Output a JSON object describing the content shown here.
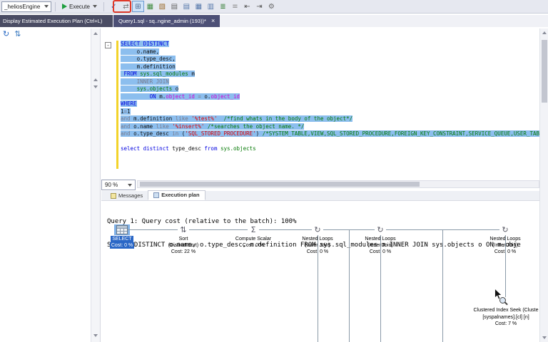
{
  "toolbar": {
    "database_combo": {
      "value": "_heliosEngine"
    },
    "execute": {
      "label": "Execute"
    },
    "icons": [
      {
        "name": "parse-query-icon",
        "glyph": "✓",
        "color": "#1f66c9"
      },
      {
        "name": "change-connection-icon",
        "glyph": "⇄",
        "color": "#777777"
      },
      {
        "name": "display-estimated-execution-plan-icon",
        "glyph": "⊞",
        "color": "#48648c",
        "highlighted": true
      },
      {
        "name": "live-query-statistics-icon",
        "glyph": "▦",
        "color": "#3f8a3f"
      },
      {
        "name": "include-actual-execution-plan-icon",
        "glyph": "▧",
        "color": "#9a6a2a"
      },
      {
        "name": "include-client-statistics-icon",
        "glyph": "▤",
        "color": "#666666"
      },
      {
        "name": "results-to-text-icon",
        "glyph": "▤",
        "color": "#5577aa"
      },
      {
        "name": "results-to-grid-icon",
        "glyph": "▦",
        "color": "#5577aa"
      },
      {
        "name": "results-to-file-icon",
        "glyph": "▥",
        "color": "#5577aa"
      },
      {
        "name": "comment-selection-icon",
        "glyph": "≣",
        "color": "#2f7a2f"
      },
      {
        "name": "uncomment-selection-icon",
        "glyph": "≡",
        "color": "#888888"
      },
      {
        "name": "decrease-indent-icon",
        "glyph": "⇤",
        "color": "#555555"
      },
      {
        "name": "increase-indent-icon",
        "glyph": "⇥",
        "color": "#555555"
      },
      {
        "name": "query-options-icon",
        "glyph": "⚙",
        "color": "#666666"
      }
    ]
  },
  "tooltip": {
    "text": "Display Estimated Execution Plan (Ctrl+L)"
  },
  "document_tab": {
    "title": "Query1.sql - sq..ngine_admin (193))*",
    "close_glyph": "×"
  },
  "left_panel": {
    "icons": [
      {
        "name": "refresh-icon",
        "glyph": "↻",
        "color": "#2668c4"
      },
      {
        "name": "sync-icon",
        "glyph": "⇅",
        "color": "#3a7ac0"
      }
    ]
  },
  "editor": {
    "collapse_glyph": "-",
    "lines": [
      {
        "selected": true,
        "segments": [
          [
            "kw",
            "SELECT DISTINCT"
          ]
        ]
      },
      {
        "selected": true,
        "segments": [
          [
            "id",
            "     o.name,"
          ]
        ]
      },
      {
        "selected": true,
        "segments": [
          [
            "id",
            "     o.type_desc,"
          ]
        ]
      },
      {
        "selected": true,
        "segments": [
          [
            "id",
            "     m.definition"
          ]
        ]
      },
      {
        "selected": true,
        "segments": [
          [
            "kw",
            " FROM "
          ],
          [
            "sys",
            "sys.sql_modules"
          ],
          [
            "id",
            " m"
          ]
        ]
      },
      {
        "selected": true,
        "segments": [
          [
            "op",
            "     INNER JOIN"
          ]
        ]
      },
      {
        "selected": true,
        "segments": [
          [
            "id",
            "     "
          ],
          [
            "sys",
            "sys.objects"
          ],
          [
            "id",
            " o"
          ]
        ]
      },
      {
        "selected": true,
        "segments": [
          [
            "id",
            "         "
          ],
          [
            "kw",
            "ON "
          ],
          [
            "id",
            "m."
          ],
          [
            "fn",
            "object_id"
          ],
          [
            "op",
            " = "
          ],
          [
            "id",
            "o."
          ],
          [
            "fn",
            "object_id"
          ]
        ]
      },
      {
        "selected": true,
        "segments": [
          [
            "kw",
            "WHERE"
          ]
        ]
      },
      {
        "selected": true,
        "segments": [
          [
            "id",
            "1"
          ],
          [
            "op",
            "="
          ],
          [
            "id",
            "1"
          ]
        ]
      },
      {
        "selected": true,
        "segments": [
          [
            "op",
            "and "
          ],
          [
            "id",
            "m.definition "
          ],
          [
            "op",
            "like "
          ],
          [
            "str",
            "'%test%'"
          ],
          [
            "id",
            "  "
          ],
          [
            "com",
            "/*find whats in the body of the object*/"
          ]
        ]
      },
      {
        "selected": true,
        "segments": [
          [
            "op",
            "and "
          ],
          [
            "id",
            "o.name "
          ],
          [
            "op",
            "like "
          ],
          [
            "str",
            "'%insert%'"
          ],
          [
            "id",
            " "
          ],
          [
            "com",
            "/*searches the object name. */"
          ]
        ]
      },
      {
        "selected": true,
        "segments": [
          [
            "op",
            "and "
          ],
          [
            "id",
            "o.type_desc "
          ],
          [
            "op",
            "in "
          ],
          [
            "id",
            "("
          ],
          [
            "str",
            "'SQL_STORED_PROCEDURE'"
          ],
          [
            "id",
            ") "
          ],
          [
            "com",
            "/*SYSTEM_TABLE,VIEW,SQL_STORED_PROCEDURE,FOREIGN_KEY_CONSTRAINT,SERVICE_QUEUE,USER_TABLE,INTERNAL_TABLE*/"
          ]
        ]
      },
      {
        "selected": false,
        "segments": []
      },
      {
        "selected": false,
        "segments": [
          [
            "kw",
            "select distinct "
          ],
          [
            "id",
            "type_desc "
          ],
          [
            "kw",
            "from "
          ],
          [
            "sys",
            "sys.objects"
          ]
        ]
      }
    ]
  },
  "zoom": {
    "value": "90 %"
  },
  "results": {
    "tabs": [
      {
        "label": "Messages",
        "icon": "messages-icon",
        "active": false
      },
      {
        "label": "Execution plan",
        "icon": "execution-plan-icon",
        "active": true
      }
    ],
    "header_line1": "Query 1: Query cost (relative to the batch): 100%",
    "header_line2": "SELECT DISTINCT o.name, o.type_desc, m.definition FROM sys.sql_modules m INNER JOIN sys.objects o ON m.obje"
  },
  "plan": {
    "nodes": [
      {
        "name": "plan-node-select",
        "icon": "result-table-icon",
        "label": "SELECT",
        "sub": "",
        "cost": "Cost: 0 %",
        "selected": true
      },
      {
        "name": "plan-node-sort",
        "icon": "sort-icon",
        "label": "Sort",
        "sub": "(Distinct Sort)",
        "cost": "Cost: 22 %",
        "selected": false
      },
      {
        "name": "plan-node-compute-scalar",
        "icon": "compute-scalar-icon",
        "label": "Compute Scalar",
        "sub": "",
        "cost": "Cost: 0 %",
        "selected": false
      },
      {
        "name": "plan-node-nested-loops-1",
        "icon": "nested-loops-icon",
        "label": "Nested Loops",
        "sub": "(Inner Join)",
        "cost": "Cost: 0 %",
        "selected": false
      },
      {
        "name": "plan-node-nested-loops-2",
        "icon": "nested-loops-icon",
        "label": "Nested Loops",
        "sub": "(Inner Join)",
        "cost": "Cost: 0 %",
        "selected": false
      },
      {
        "name": "plan-node-nested-loops-3",
        "icon": "nested-loops-icon",
        "label": "Nested Loops",
        "sub": "(Inner Join)",
        "cost": "Cost: 0 %",
        "selected": false
      }
    ],
    "icon_glyphs": {
      "sort-icon": "⇅",
      "compute-scalar-icon": "Σ",
      "nested-loops-icon": "↻"
    },
    "leaf_node": {
      "label": "Clustered Index Seek (Cluste",
      "detail": "[syspalnames].[cl] [n]",
      "cost": "Cost: 7 %"
    }
  }
}
